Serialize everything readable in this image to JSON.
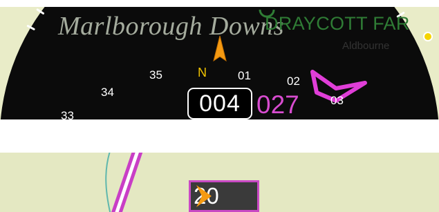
{
  "map": {
    "area_name": "Marlborough Downs",
    "airfield_name": "DRAYCOTT FAR",
    "town_name": "Aldbourne"
  },
  "compass": {
    "labels": {
      "n": "N",
      "l35": "35",
      "l01": "01",
      "l02": "02",
      "l34": "34",
      "l33": "33",
      "l03": "03"
    },
    "heading": "004",
    "track": "027",
    "north_color": "#f2c400",
    "track_color": "#d84cd0"
  },
  "speed_indicator": {
    "value": "20"
  },
  "icons": {
    "heading_pointer": "orange-arrow-icon",
    "airfield": "airfield-icon",
    "town": "town-dot-icon",
    "waypoint": "bowtie-waypoint-icon",
    "speed": "chevron-right-icon"
  }
}
